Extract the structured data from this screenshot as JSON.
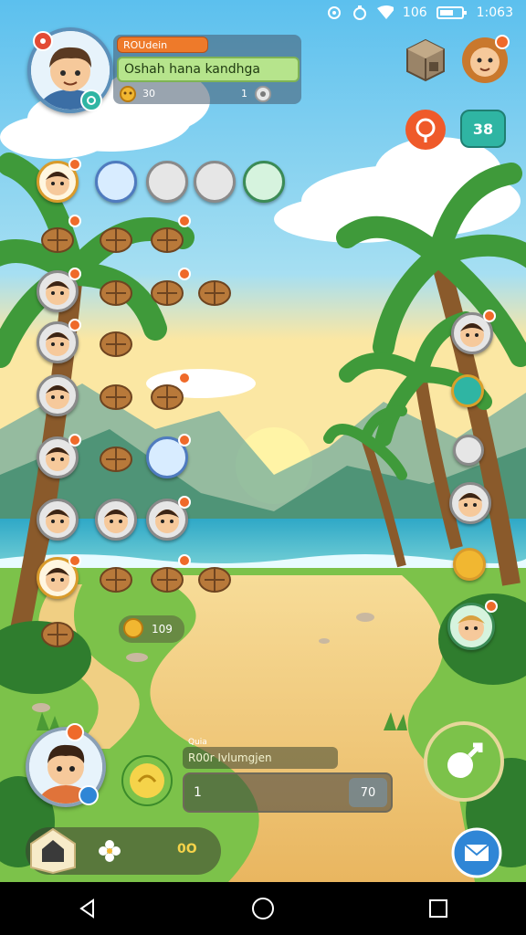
{
  "status_bar": {
    "battery_text": "106",
    "time": "1:063"
  },
  "profile": {
    "tag_label": "ROUdein",
    "display_name": "Oshah hana kandhga",
    "coins": "30",
    "gems": "1"
  },
  "top_right": {
    "counter_label": "38",
    "cube_icon": "cube-icon",
    "character_icon": "lion-character-icon"
  },
  "grid_counter": {
    "value": "109"
  },
  "bottom_panel": {
    "small_label": "Quia",
    "subtitle": "R00r Ivlumgjen",
    "input_value": "1",
    "input_counter": "70"
  },
  "bottom_bar": {
    "counter": "0O"
  },
  "colors": {
    "accent_orange": "#ee7a2a",
    "accent_teal": "#2fb5a3",
    "accent_green": "#7cc24a",
    "accent_blue": "#2f86d6"
  }
}
